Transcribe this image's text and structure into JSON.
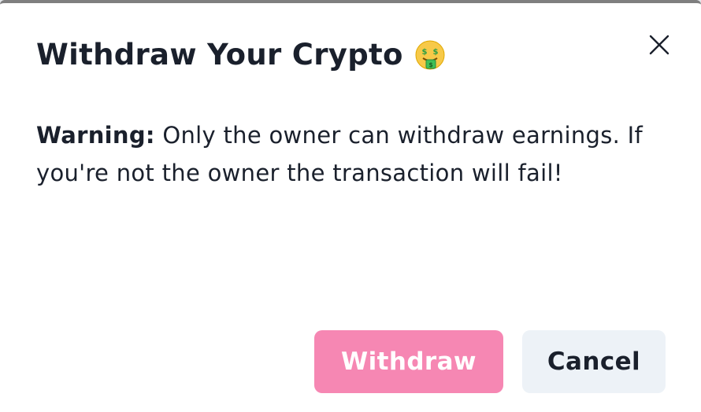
{
  "modal": {
    "title": "Withdraw Your Crypto",
    "title_emoji": "money-mouth-face-icon",
    "close_icon": "close-icon",
    "warning_label": "Warning:",
    "warning_text": " Only the owner can withdraw earnings. If you're not the owner the transaction will fail!",
    "buttons": {
      "withdraw_label": "Withdraw",
      "cancel_label": "Cancel"
    }
  },
  "colors": {
    "text": "#1a202c",
    "withdraw_bg": "#f687b3",
    "cancel_bg": "#edf2f7"
  }
}
